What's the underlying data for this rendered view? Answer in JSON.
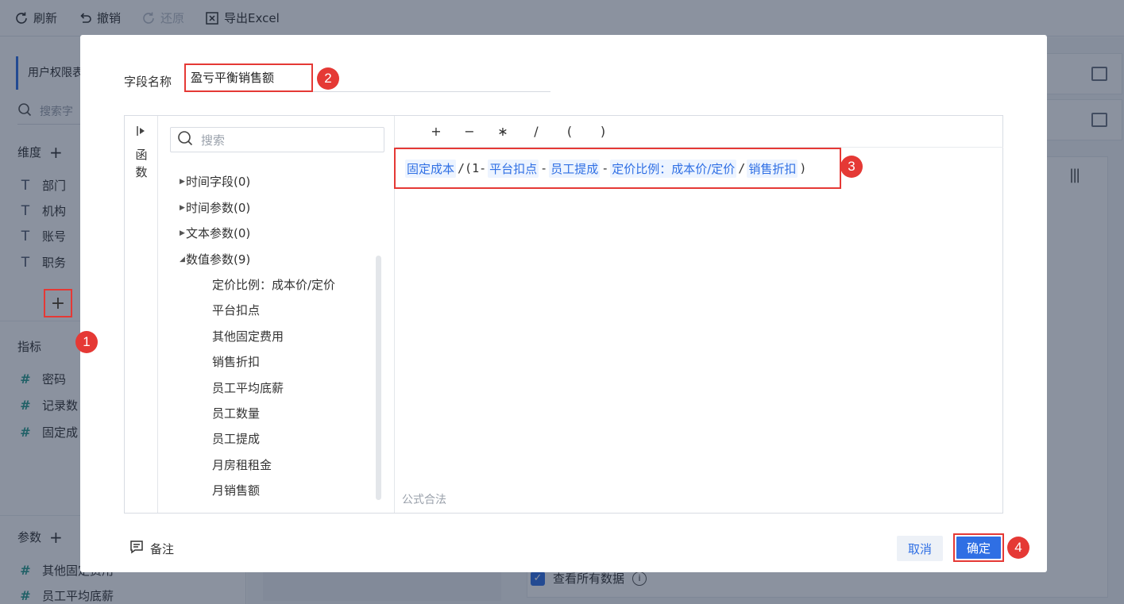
{
  "toolbar": {
    "refresh": "刷新",
    "undo": "撤销",
    "redo": "还原",
    "export": "导出Excel"
  },
  "left_panel": {
    "tab": "用户权限表",
    "search_placeholder": "搜索字",
    "dimensions_title": "维度",
    "dimensions": [
      "部门",
      "机构",
      "账号",
      "职务"
    ],
    "measures_title": "指标",
    "measures": [
      "密码",
      "记录数",
      "固定成"
    ],
    "params_title": "参数",
    "params": [
      "其他固定费用",
      "员工平均底薪"
    ]
  },
  "right_area": {
    "view_all_label": "查看所有数据"
  },
  "dialog": {
    "field_name_label": "字段名称",
    "field_name_value": "盈亏平衡销售额",
    "function_label": "函数",
    "search_placeholder": "搜索",
    "tree": {
      "groups": [
        {
          "label": "时间字段(0)",
          "expanded": false
        },
        {
          "label": "时间参数(0)",
          "expanded": false
        },
        {
          "label": "文本参数(0)",
          "expanded": false
        },
        {
          "label": "数值参数(9)",
          "expanded": true
        }
      ],
      "leaves": [
        "定价比例：成本价/定价",
        "平台扣点",
        "其他固定费用",
        "销售折扣",
        "员工平均底薪",
        "员工数量",
        "员工提成",
        "月房租租金",
        "月销售额"
      ]
    },
    "operators": [
      "+",
      "−",
      "∗",
      "/",
      "(",
      ")"
    ],
    "formula": {
      "t1": "固定成本",
      "p1": "/",
      "p2": "(1-",
      "t2": "平台扣点",
      "p3": "-",
      "t3": "员工提成",
      "p4": "-",
      "t4": "定价比例：成本价/定价",
      "p5": "/",
      "t5": "销售折扣",
      "p6": ")"
    },
    "validation": "公式合法",
    "note": "备注",
    "cancel": "取消",
    "ok": "确定"
  },
  "badges": [
    "1",
    "2",
    "3",
    "4"
  ],
  "colors": {
    "accent": "#2f6fe4",
    "highlight": "#e53935",
    "token_bg": "#edf4ff"
  }
}
